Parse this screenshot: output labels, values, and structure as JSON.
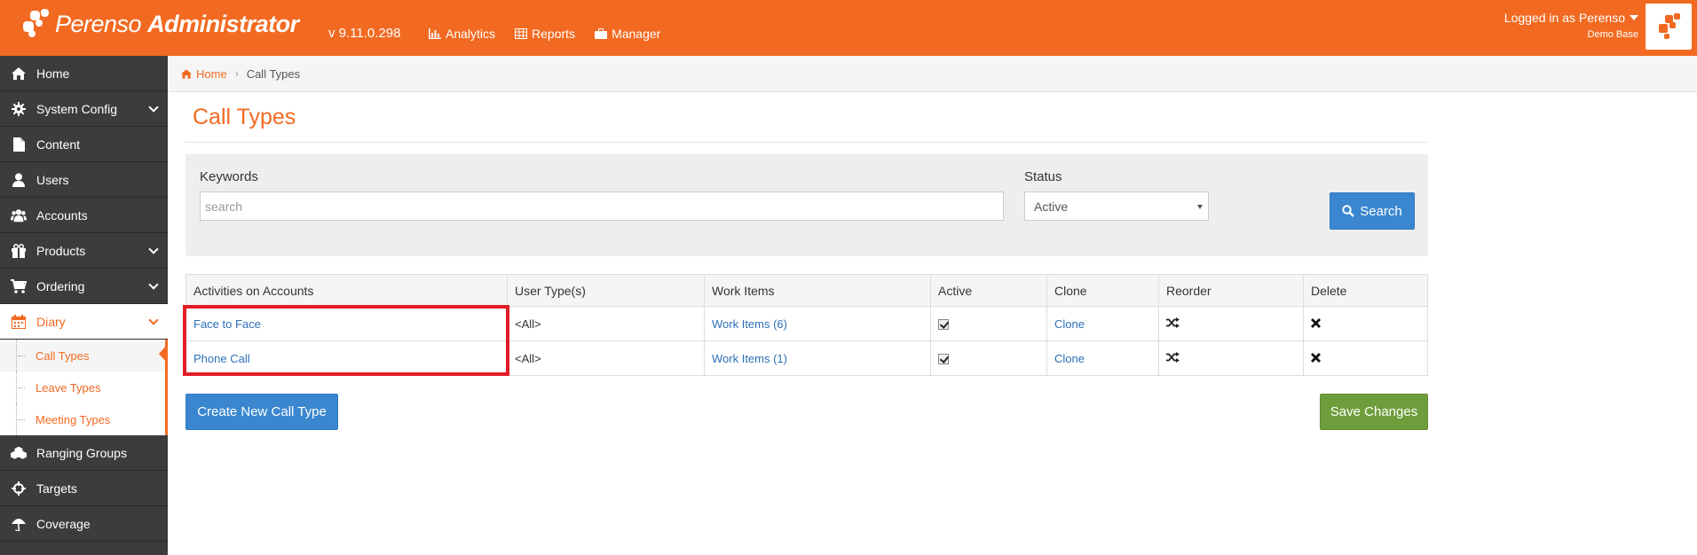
{
  "app": {
    "logo_regular": "Perenso",
    "logo_bold": "Administrator",
    "version": "v 9.11.0.298",
    "nav": [
      {
        "label": "Analytics",
        "icon": "chart-icon"
      },
      {
        "label": "Reports",
        "icon": "table-icon"
      },
      {
        "label": "Manager",
        "icon": "briefcase-icon"
      }
    ],
    "user": "Logged in as Perenso",
    "database": "Demo Base",
    "brand_color": "#f26a21"
  },
  "sidebar": {
    "items": [
      {
        "label": "Home",
        "icon": "home-icon"
      },
      {
        "label": "System Config",
        "icon": "gear-icon"
      },
      {
        "label": "Content",
        "icon": "file-icon"
      },
      {
        "label": "Users",
        "icon": "user-icon"
      },
      {
        "label": "Accounts",
        "icon": "users-icon"
      },
      {
        "label": "Products",
        "icon": "gift-icon"
      },
      {
        "label": "Ordering",
        "icon": "cart-icon"
      },
      {
        "label": "Diary",
        "icon": "calendar-icon"
      },
      {
        "label": "Ranging Groups",
        "icon": "cubes-icon"
      },
      {
        "label": "Targets",
        "icon": "crosshair-icon"
      },
      {
        "label": "Coverage",
        "icon": "umbrella-icon"
      }
    ],
    "diary_sub": [
      "Call Types",
      "Leave Types",
      "Meeting Types"
    ]
  },
  "breadcrumb": {
    "home": "Home",
    "current": "Call Types"
  },
  "page": {
    "title": "Call Types"
  },
  "filters": {
    "keywords_label": "Keywords",
    "keywords_placeholder": "search",
    "status_label": "Status",
    "status_value": "Active",
    "search_button": "Search"
  },
  "table": {
    "headers": [
      "Activities on Accounts",
      "User Type(s)",
      "Work Items",
      "Active",
      "Clone",
      "Reorder",
      "Delete"
    ],
    "rows": [
      {
        "name": "Face to Face",
        "user_types": "<All>",
        "work_items": "Work Items (6)",
        "active": true,
        "clone": "Clone"
      },
      {
        "name": "Phone Call",
        "user_types": "<All>",
        "work_items": "Work Items (1)",
        "active": true,
        "clone": "Clone"
      }
    ]
  },
  "actions": {
    "create": "Create New Call Type",
    "save": "Save Changes"
  }
}
